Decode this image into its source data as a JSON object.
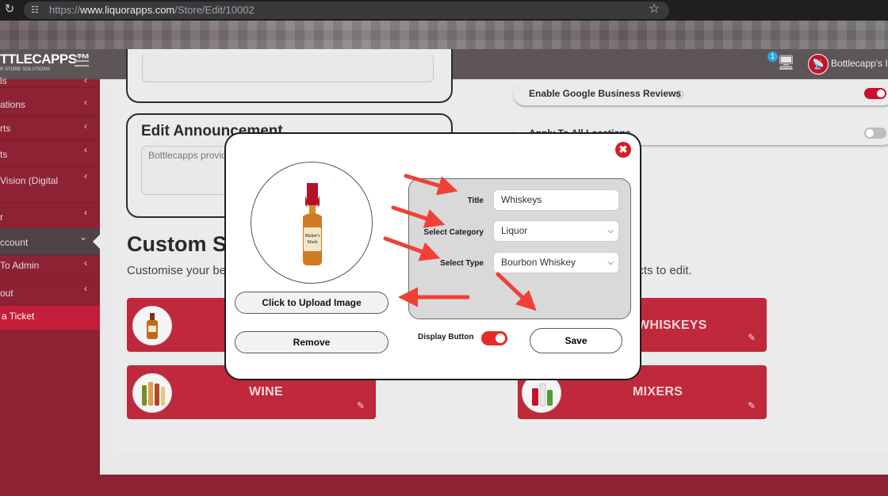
{
  "browser": {
    "url_prefix": "https://",
    "url_host": "www.liquorapps.com",
    "url_path": "/Store/Edit/10002",
    "reload_icon": "reload-icon",
    "site_settings_icon": "tune-icon",
    "bookmark_icon": "star-icon"
  },
  "header": {
    "logo_main": "TTLECAPPS™",
    "logo_sub": "R STORE SOLUTIONS",
    "notification_count": "1",
    "user_name": "Bottlecapp's Irv",
    "icons": [
      "menu-icon",
      "notification-icon",
      "avatar-icon"
    ]
  },
  "sidebar": {
    "items": [
      {
        "label": "ls"
      },
      {
        "label": "ations"
      },
      {
        "label": "rts"
      },
      {
        "label": "ts"
      },
      {
        "label": "Vision (Digital"
      },
      {
        "label": "r"
      },
      {
        "label": "ccount"
      },
      {
        "label": "To Admin"
      },
      {
        "label": "out"
      },
      {
        "label": "a Ticket"
      }
    ]
  },
  "background": {
    "edit_announcement_title": "Edit Announcement",
    "announcement_text": "Bottlecapps provid",
    "enable_reviews_label": "Enable Google Business Reviews",
    "apply_all_label": "Apply To All Locations",
    "custom_heading": "Custom Sh",
    "custom_sub_left": "Customise your be",
    "custom_sub_right": "ucts to edit.",
    "categories": [
      {
        "label": "WHISKEYS"
      },
      {
        "label": "WINE"
      },
      {
        "label": "MIXERS"
      }
    ]
  },
  "modal": {
    "bottle_label": "Maker's Mark",
    "upload_label": "Click to Upload Image",
    "remove_label": "Remove",
    "title_label": "Title",
    "title_value": "Whiskeys",
    "category_label": "Select Category",
    "category_value": "Liquor",
    "type_label": "Select Type",
    "type_value": "Bourbon Whiskey",
    "display_label": "Display Button",
    "display_on": true,
    "save_label": "Save",
    "close_icon": "close-icon"
  },
  "colors": {
    "brand_red": "#c8102e",
    "sidebar_red": "#8c2233",
    "annotation_arrow": "#ef4136"
  }
}
